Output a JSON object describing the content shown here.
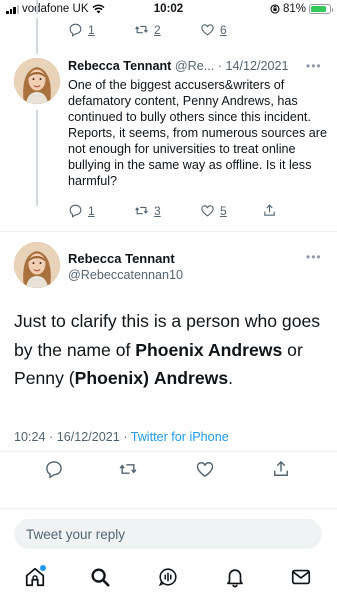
{
  "status_bar": {
    "carrier": "vodafone UK",
    "time": "10:02",
    "battery_pct": "81%",
    "battery_level": 0.81,
    "battery_color": "#34c759"
  },
  "prev_tweet_actions": {
    "replies": "1",
    "retweets": "2",
    "likes": "6"
  },
  "reply_tweet": {
    "name": "Rebecca Tennant",
    "handle": "@Re...",
    "date": "· 14/12/2021",
    "text": "One of the biggest accusers&writers of defamatory content, Penny Andrews, has continued to bully others since this incident.  Reports, it seems, from numerous sources are not enough for universities to treat online bullying in the same way as offline. Is it less harmful?",
    "replies": "1",
    "retweets": "3",
    "likes": "5"
  },
  "main_tweet": {
    "name": "Rebecca Tennant",
    "handle": "@Rebeccatennan10",
    "text_parts": {
      "p1": "Just to clarify this is a person who goes by the name of ",
      "b1": "Phoenix Andrews",
      "p2": " or Penny (",
      "b2": "Phoenix)",
      "p3": " ",
      "b3": "Andrews",
      "p4": "."
    },
    "timestamp": "10:24 · 16/12/2021 · ",
    "source": "Twitter for iPhone"
  },
  "reply_box": {
    "placeholder": "Tweet your reply"
  },
  "tab_bar": {
    "items": [
      "home-icon",
      "search-icon",
      "spaces-icon",
      "notifications-icon",
      "messages-icon"
    ],
    "accent": "#1d9bf0"
  },
  "colors": {
    "text": "#0f1419",
    "muted": "#536471",
    "link": "#1d9bf0"
  }
}
